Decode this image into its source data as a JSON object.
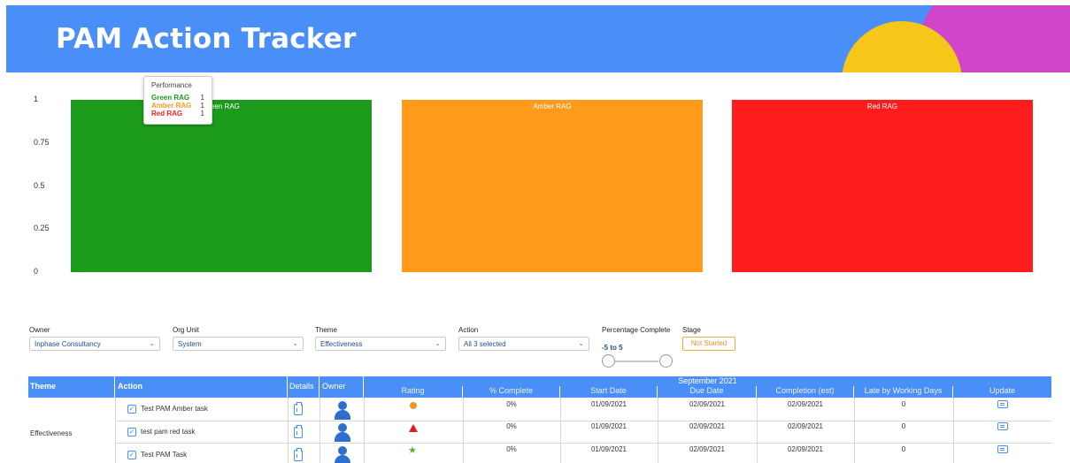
{
  "header": {
    "title": "PAM Action Tracker"
  },
  "chart_data": {
    "type": "bar",
    "categories": [
      "Green RAG",
      "Amber RAG",
      "Red RAG"
    ],
    "values": [
      1,
      1,
      1
    ],
    "colors": [
      "#1c9a1c",
      "#ff9a1a",
      "#ff1c1c"
    ],
    "yticks": [
      "1",
      "0.75",
      "0.5",
      "0.25",
      "0"
    ],
    "ylim": [
      0,
      1
    ],
    "grid": false,
    "tooltip": {
      "title": "Performance",
      "rows": [
        {
          "label": "Green RAG",
          "value": "1",
          "color": "#1c9a1c"
        },
        {
          "label": "Amber RAG",
          "value": "1",
          "color": "#ff9a1a"
        },
        {
          "label": "Red RAG",
          "value": "1",
          "color": "#ff1c1c"
        }
      ]
    }
  },
  "filters": {
    "owner": {
      "label": "Owner",
      "value": "Inphase Consultancy"
    },
    "org_unit": {
      "label": "Org Unit",
      "value": "System"
    },
    "theme": {
      "label": "Theme",
      "value": "Effectiveness"
    },
    "action": {
      "label": "Action",
      "value": "All 3 selected"
    },
    "percentage": {
      "label": "Percentage Complete",
      "range": "-5 to 5"
    },
    "stage": {
      "label": "Stage",
      "value": "Not Started"
    }
  },
  "table": {
    "headers": {
      "theme": "Theme",
      "action": "Action",
      "details": "Details",
      "owner": "Owner"
    },
    "month": "September 2021",
    "subheaders": [
      "Rating",
      "% Complete",
      "Start Date",
      "Due Date",
      "Completion (est)",
      "Late by Working Days",
      "Update"
    ],
    "theme_value": "Effectiveness",
    "rows": [
      {
        "action": "Test PAM Amber task",
        "rating": "amber-circle",
        "complete": "0%",
        "start": "01/09/2021",
        "due": "02/09/2021",
        "completion": "02/09/2021",
        "late": "0"
      },
      {
        "action": "test pam red task",
        "rating": "red-triangle",
        "complete": "0%",
        "start": "01/09/2021",
        "due": "02/09/2021",
        "completion": "02/09/2021",
        "late": "0"
      },
      {
        "action": "Test PAM Task",
        "rating": "green-star",
        "complete": "0%",
        "start": "01/09/2021",
        "due": "02/09/2021",
        "completion": "02/09/2021",
        "late": "0"
      }
    ]
  }
}
